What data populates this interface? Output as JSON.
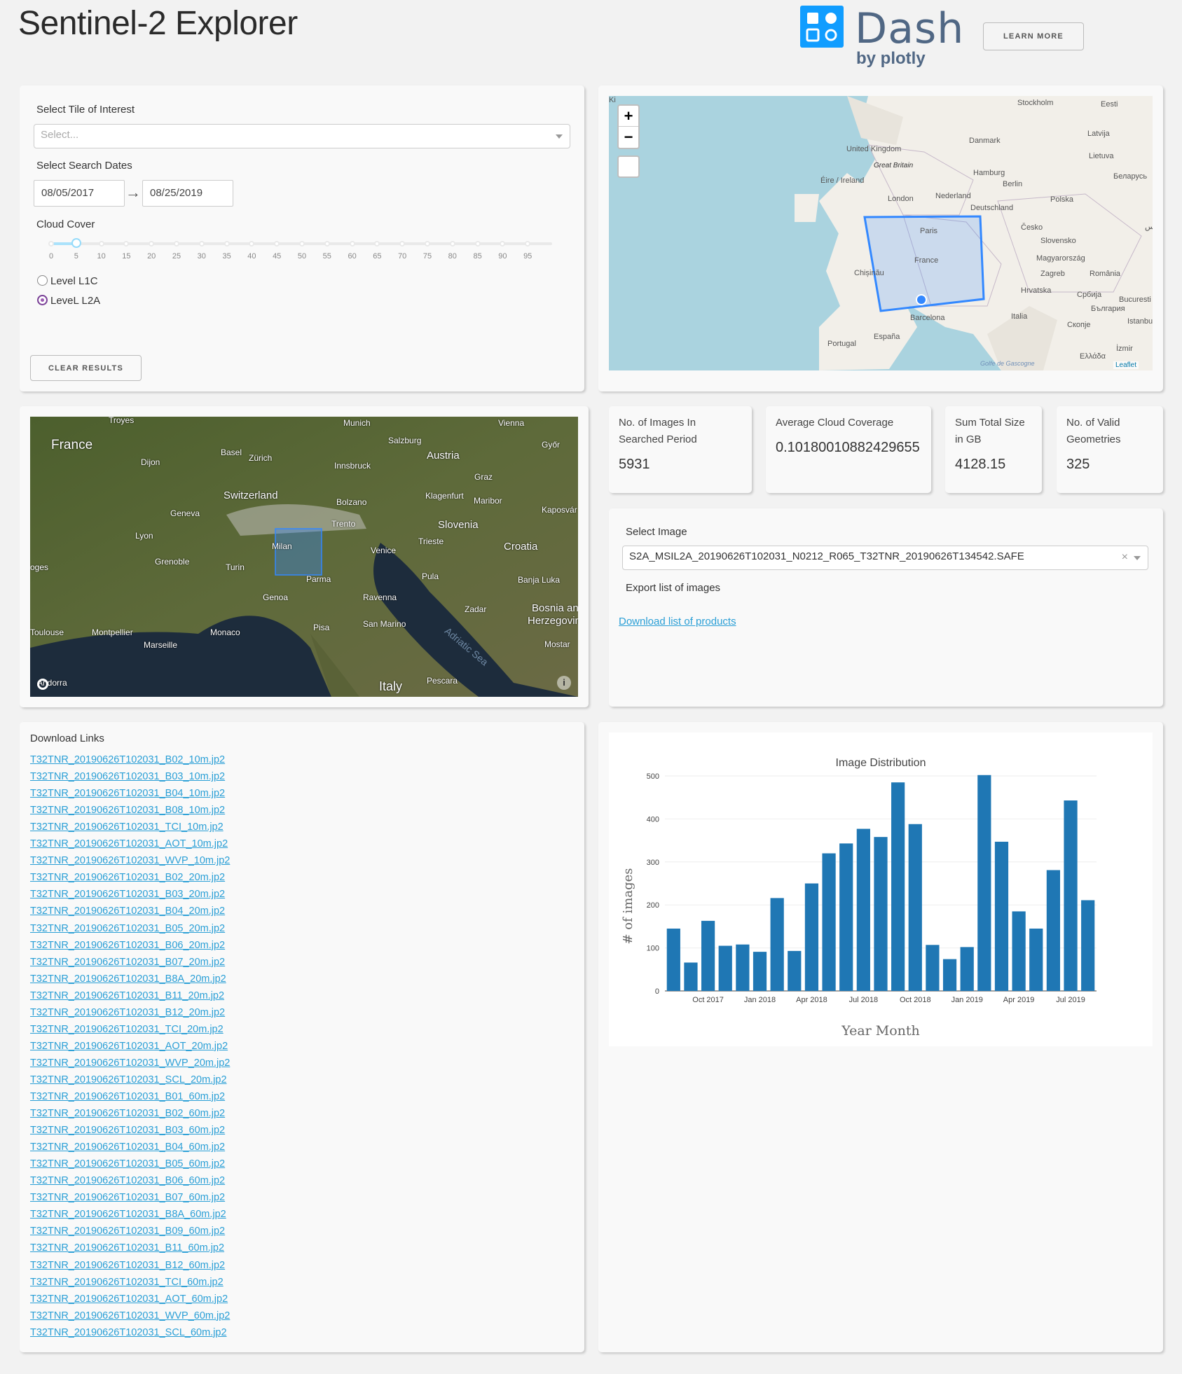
{
  "header": {
    "title": "Sentinel-2 Explorer",
    "learn_more": "LEARN MORE",
    "logo_word": "Dash",
    "logo_by": "by plotly"
  },
  "controls": {
    "tile_label": "Select Tile of Interest",
    "tile_placeholder": "Select...",
    "dates_label": "Select Search Dates",
    "start_date": "08/05/2017",
    "end_date": "08/25/2019",
    "date_arrow": "→",
    "cloud_label": "Cloud Cover",
    "cloud_value": 5,
    "cloud_ticks": [
      "0",
      "5",
      "10",
      "15",
      "20",
      "25",
      "30",
      "35",
      "40",
      "45",
      "50",
      "55",
      "60",
      "65",
      "70",
      "75",
      "80",
      "85",
      "90",
      "95"
    ],
    "radio_l1c": "Level L1C",
    "radio_l2a": "LeveL L2A",
    "clear_button": "CLEAR RESULTS"
  },
  "map_top": {
    "zoom_in": "+",
    "zoom_out": "−",
    "attribution": "Leaflet",
    "labels": [
      "Stockholm",
      "Eesti",
      "Latvija",
      "Danmark",
      "Lietuva",
      "United Kingdom",
      "Great Britain",
      "Hamburg",
      "Беларусь",
      "Éire / Ireland",
      "Berlin",
      "London",
      "Nederland",
      "Polska",
      "Deutschland",
      "Česko",
      "Paris",
      "Slovensko",
      "France",
      "Magyarország",
      "Zagreb",
      "România",
      "Hrvatska",
      "Србија",
      "Bucuresti",
      "България",
      "Barcelona",
      "Italia",
      "Скопје",
      "España",
      "Portugal",
      "İzmir",
      "Ελλάδα",
      "Istanbul",
      "Chișinău",
      "Golfe de Gascogne",
      "تونس",
      "Ki"
    ]
  },
  "map_sat": {
    "labels": [
      "France",
      "Munich",
      "Salzburg",
      "Vienna",
      "Troyes",
      "Basel",
      "Zürich",
      "Austria",
      "Győr",
      "Dijon",
      "Innsbruck",
      "Graz",
      "Switzerland",
      "Bolzano",
      "Klagenfurt",
      "Maribor",
      "Kaposvár",
      "Geneva",
      "Trento",
      "Slovenia",
      "Lyon",
      "Milan",
      "Venice",
      "Trieste",
      "Croatia",
      "Grenoble",
      "Turin",
      "Parma",
      "Pula",
      "Banja Luka",
      "Genoa",
      "Ravenna",
      "Monaco",
      "San Marino",
      "Zadar",
      "Bosnia and",
      "Herzegovina",
      "Montpellier",
      "Marseille",
      "Pisa",
      "Mostar",
      "Toulouse",
      "Italy",
      "Pescara",
      "Adriatic Sea",
      "Andorra",
      "oges"
    ]
  },
  "stats": {
    "images_title": "No. of Images In Searched Period",
    "images_value": "5931",
    "cloud_title": "Average Cloud Coverage",
    "cloud_value": "0.10180010882429655",
    "size_title": "Sum Total Size in GB",
    "size_value": "4128.15",
    "geom_title": "No. of Valid Geometries",
    "geom_value": "325"
  },
  "image_select": {
    "label": "Select Image",
    "value": "S2A_MSIL2A_20190626T102031_N0212_R065_T32TNR_20190626T134542.SAFE",
    "clear": "×",
    "export_label": "Export list of images",
    "download_link": "Download list of products"
  },
  "downloads": {
    "title": "Download Links",
    "links": [
      "T32TNR_20190626T102031_B02_10m.jp2",
      "T32TNR_20190626T102031_B03_10m.jp2",
      "T32TNR_20190626T102031_B04_10m.jp2",
      "T32TNR_20190626T102031_B08_10m.jp2",
      "T32TNR_20190626T102031_TCI_10m.jp2",
      "T32TNR_20190626T102031_AOT_10m.jp2",
      "T32TNR_20190626T102031_WVP_10m.jp2",
      "T32TNR_20190626T102031_B02_20m.jp2",
      "T32TNR_20190626T102031_B03_20m.jp2",
      "T32TNR_20190626T102031_B04_20m.jp2",
      "T32TNR_20190626T102031_B05_20m.jp2",
      "T32TNR_20190626T102031_B06_20m.jp2",
      "T32TNR_20190626T102031_B07_20m.jp2",
      "T32TNR_20190626T102031_B8A_20m.jp2",
      "T32TNR_20190626T102031_B11_20m.jp2",
      "T32TNR_20190626T102031_B12_20m.jp2",
      "T32TNR_20190626T102031_TCI_20m.jp2",
      "T32TNR_20190626T102031_AOT_20m.jp2",
      "T32TNR_20190626T102031_WVP_20m.jp2",
      "T32TNR_20190626T102031_SCL_20m.jp2",
      "T32TNR_20190626T102031_B01_60m.jp2",
      "T32TNR_20190626T102031_B02_60m.jp2",
      "T32TNR_20190626T102031_B03_60m.jp2",
      "T32TNR_20190626T102031_B04_60m.jp2",
      "T32TNR_20190626T102031_B05_60m.jp2",
      "T32TNR_20190626T102031_B06_60m.jp2",
      "T32TNR_20190626T102031_B07_60m.jp2",
      "T32TNR_20190626T102031_B8A_60m.jp2",
      "T32TNR_20190626T102031_B09_60m.jp2",
      "T32TNR_20190626T102031_B11_60m.jp2",
      "T32TNR_20190626T102031_B12_60m.jp2",
      "T32TNR_20190626T102031_TCI_60m.jp2",
      "T32TNR_20190626T102031_AOT_60m.jp2",
      "T32TNR_20190626T102031_WVP_60m.jp2",
      "T32TNR_20190626T102031_SCL_60m.jp2"
    ]
  },
  "chart_data": {
    "type": "bar",
    "title": "Image Distribution",
    "xlabel": "Year Month",
    "ylabel": "# of images",
    "ylim": [
      0,
      520
    ],
    "yticks": [
      0,
      100,
      200,
      300,
      400,
      500
    ],
    "xtick_labels": [
      "Oct 2017",
      "Jan 2018",
      "Apr 2018",
      "Jul 2018",
      "Oct 2018",
      "Jan 2019",
      "Apr 2019",
      "Jul 2019"
    ],
    "categories": [
      "2017-08",
      "2017-09",
      "2017-10",
      "2017-11",
      "2017-12",
      "2018-01",
      "2018-02",
      "2018-03",
      "2018-04",
      "2018-05",
      "2018-06",
      "2018-07",
      "2018-08",
      "2018-09",
      "2018-10",
      "2018-11",
      "2018-12",
      "2019-01",
      "2019-02",
      "2019-03",
      "2019-04",
      "2019-05",
      "2019-06",
      "2019-07",
      "2019-08"
    ],
    "values": [
      145,
      66,
      163,
      105,
      108,
      91,
      216,
      93,
      250,
      320,
      343,
      377,
      358,
      485,
      388,
      107,
      74,
      102,
      502,
      347,
      185,
      145,
      281,
      443,
      211
    ],
    "bar_color": "#1f77b4",
    "grid": true
  }
}
